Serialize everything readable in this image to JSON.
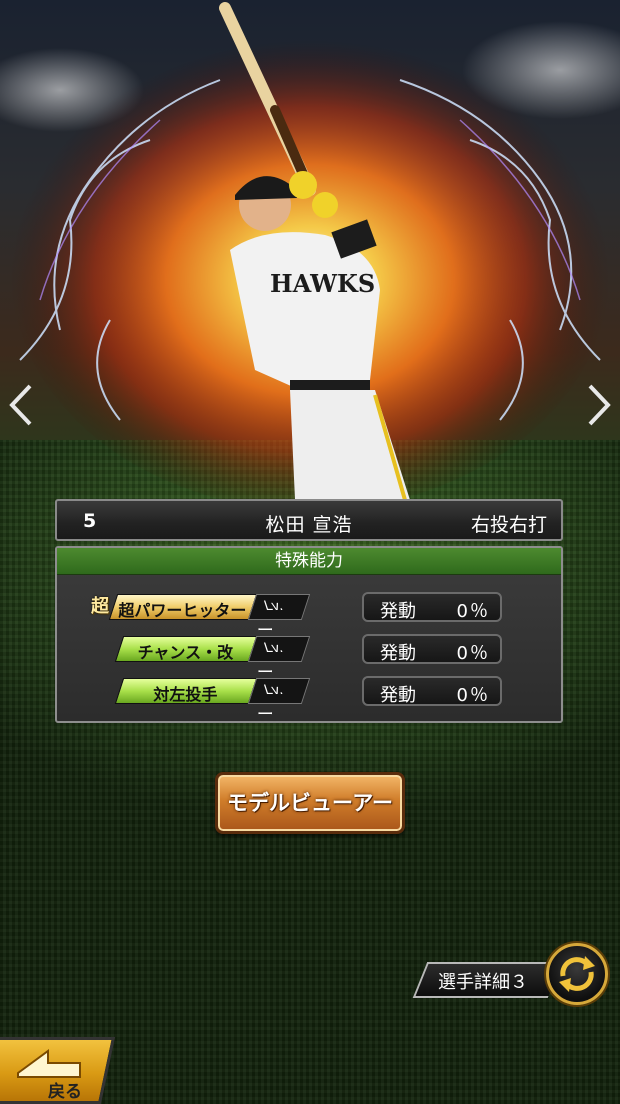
{
  "player": {
    "number": "5",
    "name": "松田 宣浩",
    "throw_bat": "右投右打"
  },
  "abilities": {
    "header": "特殊能力",
    "super_badge": "超",
    "items": [
      {
        "name": "超パワーヒッター",
        "level_prefix": "Lv.",
        "level": "ー",
        "status_label": "発動",
        "rate": "0％",
        "tag": "gold"
      },
      {
        "name": "チャンス・改",
        "level_prefix": "Lv.",
        "level": "ー",
        "status_label": "発動",
        "rate": "0％",
        "tag": "green"
      },
      {
        "name": "対左投手",
        "level_prefix": "Lv.",
        "level": "ー",
        "status_label": "発動",
        "rate": "0％",
        "tag": "green"
      }
    ]
  },
  "buttons": {
    "model_viewer": "モデルビューアー",
    "detail_tab": "選手詳細３",
    "back": "戻る"
  },
  "icons": {
    "prev": "chevron-left-icon",
    "next": "chevron-right-icon",
    "refresh": "refresh-arrows-icon",
    "back": "back-arrow-icon"
  },
  "colors": {
    "gold_tag": "#f0cd6a",
    "green_tag": "#a9e04a",
    "header_green": "#3f7a26",
    "button_orange": "#d07d2a"
  }
}
